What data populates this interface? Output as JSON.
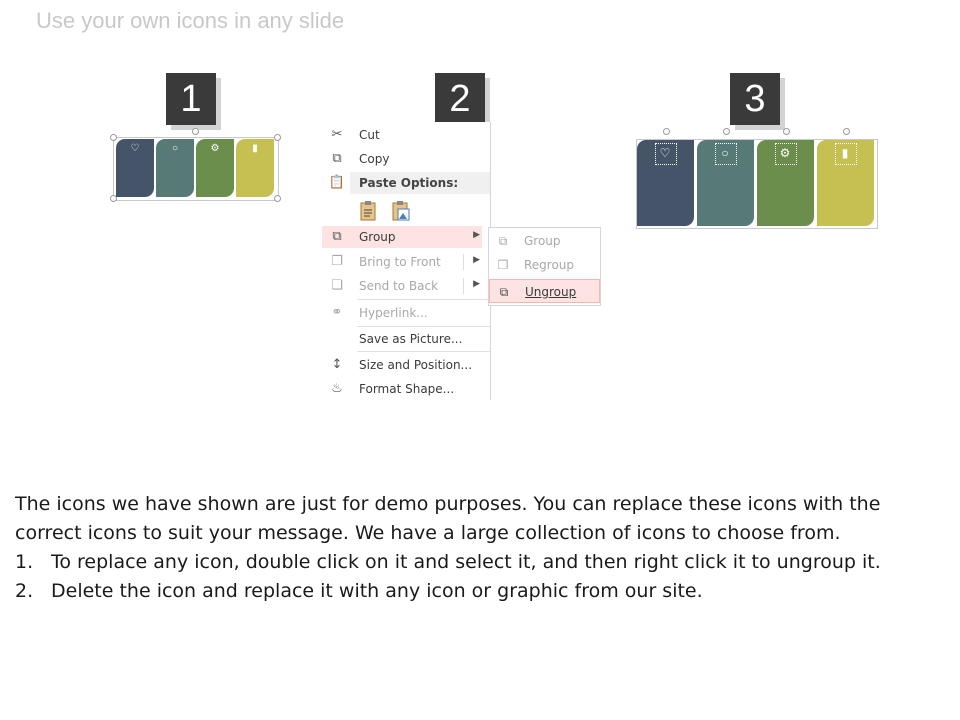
{
  "title": "Use your own icons in any slide",
  "steps": [
    "1",
    "2",
    "3"
  ],
  "colors": {
    "tile1": "#46546a",
    "tile2": "#577a76",
    "tile3": "#6c8e4c",
    "tile4": "#c6c052",
    "highlight": "#fde4e3"
  },
  "tile_icons": [
    "heart-icon",
    "lightbulb-icon",
    "gear-icon",
    "bar-chart-icon"
  ],
  "context_menu": {
    "cut": "Cut",
    "copy": "Copy",
    "paste_options": "Paste Options:",
    "group": "Group",
    "bring_to_front": "Bring to Front",
    "send_to_back": "Send to Back",
    "hyperlink": "Hyperlink...",
    "save_as_picture": "Save as Picture...",
    "size_and_position": "Size and Position...",
    "format_shape": "Format Shape..."
  },
  "submenu": {
    "group": "Group",
    "regroup": "Regroup",
    "ungroup": "Ungroup"
  },
  "body": {
    "intro": "The icons we have shown are just for demo purposes. You can replace these icons with the correct icons to suit your message. We have a large collection of icons to choose from.",
    "items": [
      {
        "num": "1.",
        "text": "To replace any icon, double click on it and select it, and then right click it to ungroup it."
      },
      {
        "num": "2.",
        "text": "Delete the icon and replace it with any icon or graphic from our site."
      }
    ]
  }
}
